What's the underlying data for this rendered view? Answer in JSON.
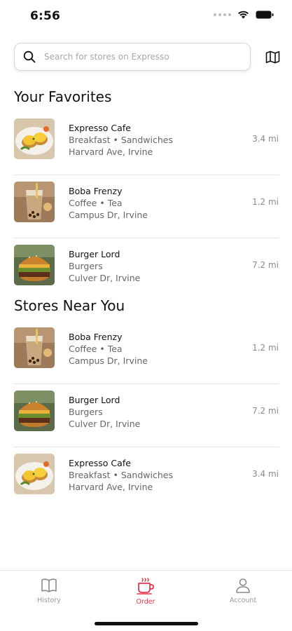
{
  "status_bar": {
    "time": "6:56"
  },
  "search": {
    "placeholder": "Search for stores on Expresso"
  },
  "favorites": {
    "title": "Your Favorites",
    "stores": [
      {
        "name": "Expresso Cafe",
        "category": "Breakfast • Sandwiches",
        "address": "Harvard Ave, Irvine",
        "distance": "3.4 mi",
        "image": "egg-benedict"
      },
      {
        "name": "Boba Frenzy",
        "category": "Coffee • Tea",
        "address": "Campus Dr, Irvine",
        "distance": "1.2 mi",
        "image": "boba-tea"
      },
      {
        "name": "Burger Lord",
        "category": "Burgers",
        "address": "Culver Dr, Irvine",
        "distance": "7.2 mi",
        "image": "burger"
      }
    ]
  },
  "nearby": {
    "title": "Stores Near You",
    "stores": [
      {
        "name": "Boba Frenzy",
        "category": "Coffee • Tea",
        "address": "Campus Dr, Irvine",
        "distance": "1.2 mi",
        "image": "boba-tea"
      },
      {
        "name": "Burger Lord",
        "category": "Burgers",
        "address": "Culver Dr, Irvine",
        "distance": "7.2 mi",
        "image": "burger"
      },
      {
        "name": "Expresso Cafe",
        "category": "Breakfast • Sandwiches",
        "address": "Harvard Ave, Irvine",
        "distance": "3.4 mi",
        "image": "egg-benedict"
      }
    ]
  },
  "tab_bar": {
    "tabs": [
      {
        "label": "History",
        "icon": "book-icon",
        "active": false
      },
      {
        "label": "Order",
        "icon": "coffee-cup-icon",
        "active": true
      },
      {
        "label": "Account",
        "icon": "person-icon",
        "active": false
      }
    ]
  },
  "colors": {
    "accent": "#e8364e",
    "divider": "#e4e4e4",
    "muted_text": "#666666"
  }
}
